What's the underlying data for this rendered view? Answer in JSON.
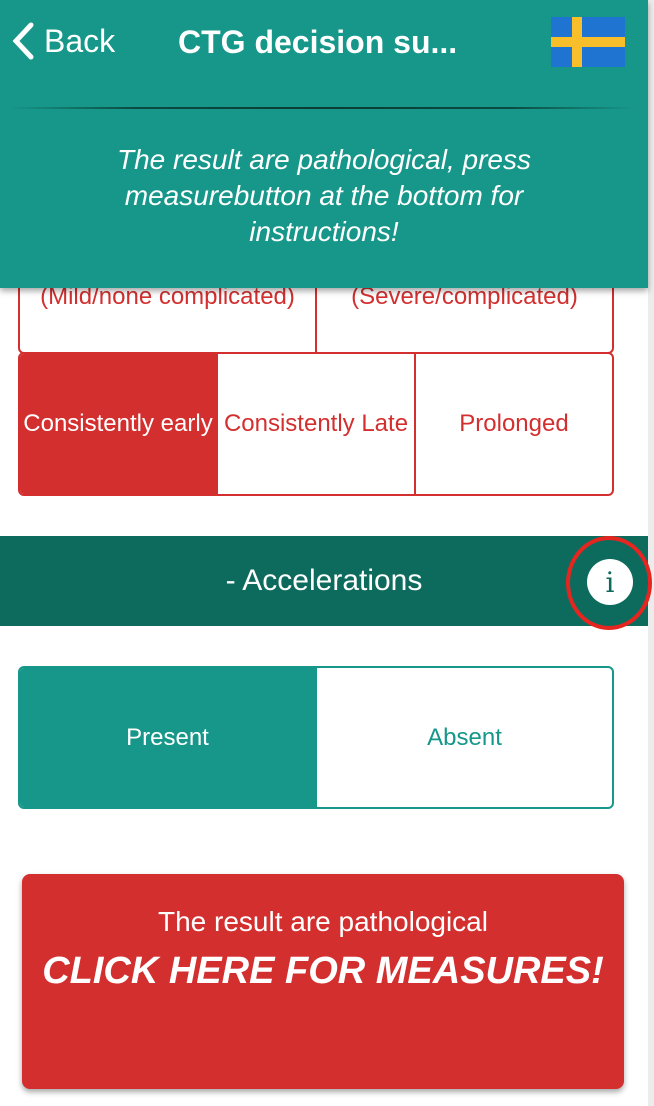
{
  "header": {
    "back_label": "Back",
    "title": "CTG decision su...",
    "flag_icon": "sweden-flag-icon",
    "message": "The result are pathological, press measurebutton at the bottom for instructions!"
  },
  "decelerations": {
    "row1": [
      "(Mild/none complicated)",
      "(Severe/complicated)"
    ],
    "row2": [
      {
        "label": "Consistently early",
        "selected": true
      },
      {
        "label": "Consistently Late",
        "selected": false
      },
      {
        "label": "Prolonged",
        "selected": false
      }
    ]
  },
  "accelerations": {
    "title": "- Accelerations",
    "info_icon": "i",
    "options": [
      {
        "label": "Present",
        "selected": true
      },
      {
        "label": "Absent",
        "selected": false
      }
    ]
  },
  "measure": {
    "line1": "The result are pathological",
    "line2": "CLICK HERE FOR MEASURES!"
  },
  "colors": {
    "teal": "#17978a",
    "dark_teal": "#0d6b5d",
    "red": "#d32f2f"
  }
}
